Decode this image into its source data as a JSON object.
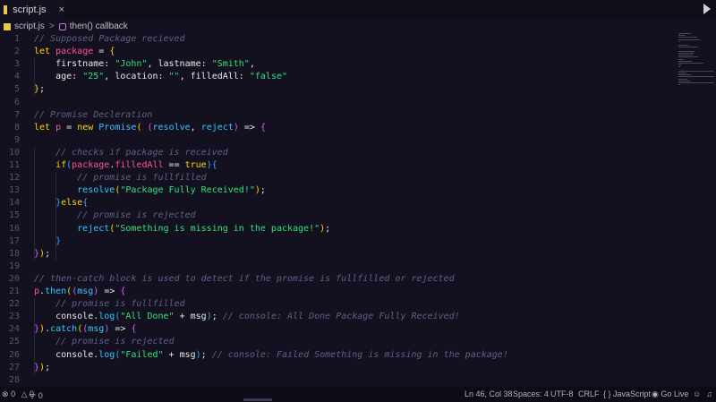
{
  "tab": {
    "label": "script.js",
    "close": "×"
  },
  "breadcrumb": {
    "file": "script.js",
    "sep": ">",
    "symbol": "then() callback"
  },
  "status": {
    "errors": "0",
    "warnings": "0",
    "live_share": "0",
    "position": "Ln 46, Col 38",
    "spaces": "Spaces: 4",
    "encoding": "UTF-8",
    "eol": "CRLF",
    "language": "JavaScript",
    "go_live": "Go Live"
  },
  "code_lines": [
    {
      "n": "1",
      "tokens": [
        [
          "cm",
          "// Supposed Package recieved"
        ]
      ]
    },
    {
      "n": "2",
      "tokens": [
        [
          "kw",
          "let "
        ],
        [
          "var",
          "package"
        ],
        [
          "prop",
          " = "
        ],
        [
          "br1",
          "{"
        ]
      ]
    },
    {
      "n": "3",
      "tokens": [
        [
          "prop",
          "    firstname: "
        ],
        [
          "str",
          "\"John\""
        ],
        [
          "prop",
          ", lastname: "
        ],
        [
          "str",
          "\"Smith\""
        ],
        [
          "prop",
          ","
        ]
      ]
    },
    {
      "n": "4",
      "tokens": [
        [
          "prop",
          "    age: "
        ],
        [
          "str",
          "\"25\""
        ],
        [
          "prop",
          ", location: "
        ],
        [
          "str",
          "\"\""
        ],
        [
          "prop",
          ", filledAll: "
        ],
        [
          "str",
          "\"false\""
        ]
      ]
    },
    {
      "n": "5",
      "tokens": [
        [
          "br1",
          "}"
        ],
        [
          "prop",
          ";"
        ]
      ]
    },
    {
      "n": "6",
      "tokens": []
    },
    {
      "n": "7",
      "tokens": [
        [
          "cm",
          "// Promise Decleration"
        ]
      ]
    },
    {
      "n": "8",
      "tokens": [
        [
          "kw",
          "let "
        ],
        [
          "var",
          "p"
        ],
        [
          "prop",
          " = "
        ],
        [
          "kw",
          "new "
        ],
        [
          "fn",
          "Promise"
        ],
        [
          "br1",
          "( "
        ],
        [
          "br2",
          "("
        ],
        [
          "fn",
          "resolve"
        ],
        [
          "prop",
          ", "
        ],
        [
          "fn",
          "reject"
        ],
        [
          "br2",
          ")"
        ],
        [
          "prop",
          " => "
        ],
        [
          "br2",
          "{"
        ]
      ]
    },
    {
      "n": "9",
      "tokens": []
    },
    {
      "n": "10",
      "tokens": [
        [
          "cm",
          "    // checks if package is received"
        ]
      ]
    },
    {
      "n": "11",
      "tokens": [
        [
          "kw",
          "    if"
        ],
        [
          "br3",
          "("
        ],
        [
          "var",
          "package"
        ],
        [
          "prop",
          "."
        ],
        [
          "var",
          "filledAll"
        ],
        [
          "prop",
          " == "
        ],
        [
          "kw",
          "true"
        ],
        [
          "br3",
          ")"
        ],
        [
          "br3",
          "{"
        ]
      ]
    },
    {
      "n": "12",
      "tokens": [
        [
          "cm",
          "        // promise is fullfilled"
        ]
      ]
    },
    {
      "n": "13",
      "tokens": [
        [
          "fn",
          "        resolve"
        ],
        [
          "br1",
          "("
        ],
        [
          "str",
          "\"Package Fully Received!\""
        ],
        [
          "br1",
          ")"
        ],
        [
          "prop",
          ";"
        ]
      ]
    },
    {
      "n": "14",
      "tokens": [
        [
          "br3",
          "    }"
        ],
        [
          "kw",
          "else"
        ],
        [
          "br3",
          "{"
        ]
      ]
    },
    {
      "n": "15",
      "tokens": [
        [
          "cm",
          "        // promise is rejected"
        ]
      ]
    },
    {
      "n": "16",
      "tokens": [
        [
          "fn",
          "        reject"
        ],
        [
          "br1",
          "("
        ],
        [
          "str",
          "\"Something is missing in the package!\""
        ],
        [
          "br1",
          ")"
        ],
        [
          "prop",
          ";"
        ]
      ]
    },
    {
      "n": "17",
      "tokens": [
        [
          "br3",
          "    }"
        ]
      ]
    },
    {
      "n": "18",
      "tokens": [
        [
          "br2",
          "}"
        ],
        [
          "br1",
          ")"
        ],
        [
          "prop",
          ";"
        ]
      ]
    },
    {
      "n": "19",
      "tokens": []
    },
    {
      "n": "20",
      "tokens": [
        [
          "cm",
          "// then-catch block is used to detect if the promise is fullfilled or rejected"
        ]
      ]
    },
    {
      "n": "21",
      "tokens": [
        [
          "var",
          "p"
        ],
        [
          "prop",
          "."
        ],
        [
          "fn",
          "then"
        ],
        [
          "br1",
          "("
        ],
        [
          "br2",
          "("
        ],
        [
          "fn",
          "msg"
        ],
        [
          "br2",
          ")"
        ],
        [
          "prop",
          " => "
        ],
        [
          "br2",
          "{"
        ]
      ]
    },
    {
      "n": "22",
      "tokens": [
        [
          "cm",
          "    // promise is fullfilled"
        ]
      ]
    },
    {
      "n": "23",
      "tokens": [
        [
          "prop",
          "    console."
        ],
        [
          "fn",
          "log"
        ],
        [
          "br3",
          "("
        ],
        [
          "str",
          "\"All Done\""
        ],
        [
          "prop",
          " + msg"
        ],
        [
          "br3",
          ")"
        ],
        [
          "prop",
          "; "
        ],
        [
          "cm",
          "// console: All Done Package Fully Received!"
        ]
      ]
    },
    {
      "n": "24",
      "tokens": [
        [
          "br2",
          "}"
        ],
        [
          "br1",
          ")"
        ],
        [
          "prop",
          "."
        ],
        [
          "fn",
          "catch"
        ],
        [
          "br1",
          "("
        ],
        [
          "br2",
          "("
        ],
        [
          "fn",
          "msg"
        ],
        [
          "br2",
          ")"
        ],
        [
          "prop",
          " => "
        ],
        [
          "br2",
          "{"
        ]
      ]
    },
    {
      "n": "25",
      "tokens": [
        [
          "cm",
          "    // promise is rejected"
        ]
      ]
    },
    {
      "n": "26",
      "tokens": [
        [
          "prop",
          "    console."
        ],
        [
          "fn",
          "log"
        ],
        [
          "br3",
          "("
        ],
        [
          "str",
          "\"Failed\""
        ],
        [
          "prop",
          " + msg"
        ],
        [
          "br3",
          ")"
        ],
        [
          "prop",
          "; "
        ],
        [
          "cm",
          "// console: Failed Something is missing in the package!"
        ]
      ]
    },
    {
      "n": "27",
      "tokens": [
        [
          "br2",
          "}"
        ],
        [
          "br1",
          ")"
        ],
        [
          "prop",
          ";"
        ]
      ]
    },
    {
      "n": "28",
      "tokens": []
    }
  ]
}
